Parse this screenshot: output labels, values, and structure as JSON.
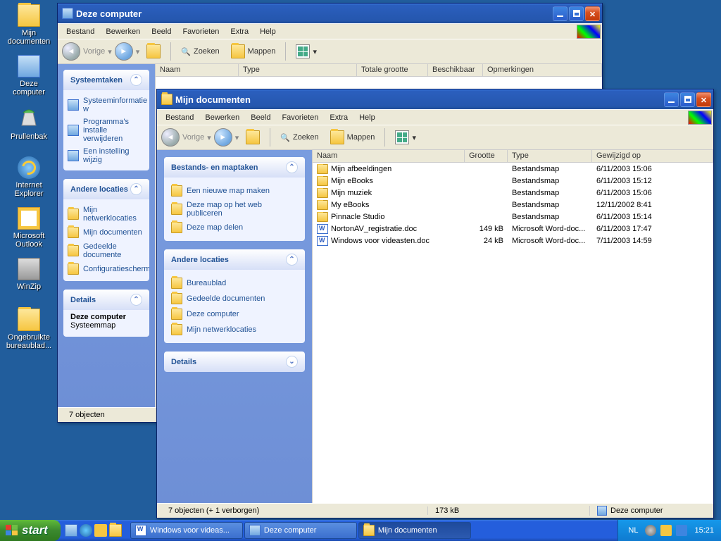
{
  "desktop": {
    "icons": [
      {
        "label": "Mijn documenten"
      },
      {
        "label": "Deze computer"
      },
      {
        "label": "Prullenbak"
      },
      {
        "label": "Internet Explorer"
      },
      {
        "label": "Microsoft Outlook"
      },
      {
        "label": "WinZip"
      },
      {
        "label": "Ongebruikte bureaublad..."
      }
    ]
  },
  "back_window": {
    "title": "Deze computer",
    "menu": [
      "Bestand",
      "Bewerken",
      "Beeld",
      "Favorieten",
      "Extra",
      "Help"
    ],
    "toolbar": {
      "back": "Vorige",
      "search": "Zoeken",
      "folders": "Mappen"
    },
    "columns": [
      "Naam",
      "Type",
      "Totale grootte",
      "Beschikbaar",
      "Opmerkingen"
    ],
    "side": {
      "systasks": {
        "title": "Systeemtaken",
        "items": [
          "Systeeminformatie w",
          "Programma's installe verwijderen",
          "Een instelling wijzig"
        ]
      },
      "other": {
        "title": "Andere locaties",
        "items": [
          "Mijn netwerklocaties",
          "Mijn documenten",
          "Gedeelde documente",
          "Configuratiescherm"
        ]
      },
      "details": {
        "title": "Details",
        "name": "Deze computer",
        "sub": "Systeemmap"
      }
    },
    "status": "7 objecten"
  },
  "front_window": {
    "title": "Mijn documenten",
    "menu": [
      "Bestand",
      "Bewerken",
      "Beeld",
      "Favorieten",
      "Extra",
      "Help"
    ],
    "toolbar": {
      "back": "Vorige",
      "search": "Zoeken",
      "folders": "Mappen"
    },
    "columns": [
      "Naam",
      "Grootte",
      "Type",
      "Gewijzigd op"
    ],
    "side": {
      "filetasks": {
        "title": "Bestands- en maptaken",
        "items": [
          "Een nieuwe map maken",
          "Deze map op het web publiceren",
          "Deze map delen"
        ]
      },
      "other": {
        "title": "Andere locaties",
        "items": [
          "Bureaublad",
          "Gedeelde documenten",
          "Deze computer",
          "Mijn netwerklocaties"
        ]
      },
      "details": {
        "title": "Details"
      }
    },
    "files": [
      {
        "icon": "folder",
        "name": "Mijn afbeeldingen",
        "size": "",
        "type": "Bestandsmap",
        "date": "6/11/2003 15:06"
      },
      {
        "icon": "folder",
        "name": "Mijn eBooks",
        "size": "",
        "type": "Bestandsmap",
        "date": "6/11/2003 15:12"
      },
      {
        "icon": "folder",
        "name": "Mijn muziek",
        "size": "",
        "type": "Bestandsmap",
        "date": "6/11/2003 15:06"
      },
      {
        "icon": "folder",
        "name": "My eBooks",
        "size": "",
        "type": "Bestandsmap",
        "date": "12/11/2002 8:41"
      },
      {
        "icon": "folder",
        "name": "Pinnacle Studio",
        "size": "",
        "type": "Bestandsmap",
        "date": "6/11/2003 15:14"
      },
      {
        "icon": "word",
        "name": "NortonAV_registratie.doc",
        "size": "149 kB",
        "type": "Microsoft Word-doc...",
        "date": "6/11/2003 17:47"
      },
      {
        "icon": "word",
        "name": "Windows voor videasten.doc",
        "size": "24 kB",
        "type": "Microsoft Word-doc...",
        "date": "7/11/2003 14:59"
      }
    ],
    "status": {
      "left": "7 objecten (+ 1 verborgen)",
      "mid": "173 kB",
      "right": "Deze computer"
    }
  },
  "taskbar": {
    "start": "start",
    "tasks": [
      {
        "label": "Windows voor videas...",
        "active": false
      },
      {
        "label": "Deze computer",
        "active": false
      },
      {
        "label": "Mijn documenten",
        "active": true
      }
    ],
    "lang": "NL",
    "clock": "15:21"
  }
}
